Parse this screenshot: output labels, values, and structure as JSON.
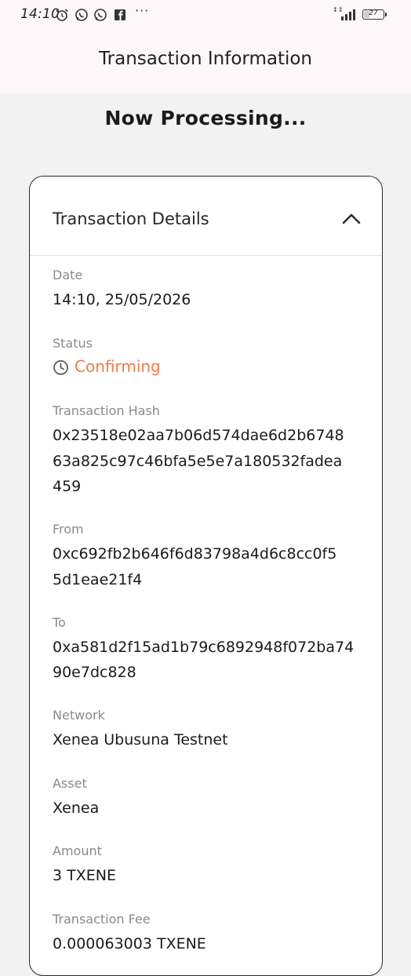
{
  "status_bar": {
    "time": "14:10",
    "notification_icons": [
      "alarm-icon",
      "whatsapp-icon",
      "whatsapp-icon",
      "facebook-icon"
    ],
    "more_label": "···",
    "signal_label": "",
    "battery_level": "27"
  },
  "header": {
    "title": "Transaction Information"
  },
  "status_heading": "Now Processing...",
  "details": {
    "title": "Transaction Details",
    "date_label": "Date",
    "date_value": "14:10, 25/05/2026",
    "status_label": "Status",
    "status_value": "Confirming",
    "hash_label": "Transaction Hash",
    "hash_line1": "0x23518e02aa7b06d574dae6d2b6748",
    "hash_line2": "63a825c97c46bfa5e5e7a180532fadea",
    "hash_line3": "459",
    "from_label": "From",
    "from_line1": "0xc692fb2b646f6d83798a4d6c8cc0f5",
    "from_line2": "5d1eae21f4",
    "to_label": "To",
    "to_line1": "0xa581d2f15ad1b79c6892948f072ba74",
    "to_line2": "90e7dc828",
    "network_label": "Network",
    "network_value": "Xenea Ubusuna Testnet",
    "asset_label": "Asset",
    "asset_value": "Xenea",
    "amount_label": "Amount",
    "amount_value": "3 TXENE",
    "fee_label": "Transaction Fee",
    "fee_value": "0.000063003 TXENE"
  },
  "colors": {
    "status_confirming": "#f07c46",
    "header_bg": "#fdf7fa",
    "page_bg": "#f2f2f2",
    "card_border": "#2a2a2a"
  }
}
